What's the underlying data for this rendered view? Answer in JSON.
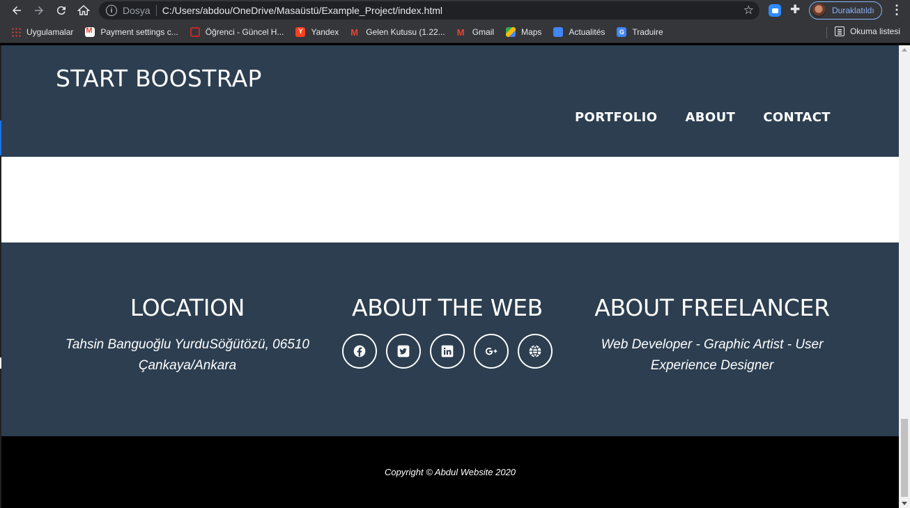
{
  "browser": {
    "address": {
      "scheme_label": "Dosya",
      "url": "C:/Users/abdou/OneDrive/Masaüstü/Example_Project/index.html"
    },
    "profile_label": "Duraklatıldı",
    "bookmarks": [
      {
        "label": "Uygulamalar",
        "icon": "apps-icon"
      },
      {
        "label": "Payment settings c...",
        "icon": "gmail-icon"
      },
      {
        "label": "Öğrenci - Güncel H...",
        "icon": "shield-icon"
      },
      {
        "label": "Yandex",
        "icon": "yandex-icon"
      },
      {
        "label": "Gelen Kutusu (1.22...",
        "icon": "gmail-icon"
      },
      {
        "label": "Gmail",
        "icon": "gmail-icon"
      },
      {
        "label": "Maps",
        "icon": "maps-icon"
      },
      {
        "label": "Actualités",
        "icon": "news-icon"
      },
      {
        "label": "Traduire",
        "icon": "translate-icon"
      }
    ],
    "reading_list_label": "Okuma listesi"
  },
  "site": {
    "brand": "START BOOSTRAP",
    "nav": [
      "PORTFOLIO",
      "ABOUT",
      "CONTACT"
    ]
  },
  "footer": {
    "location": {
      "title": "LOCATION",
      "text": "Tahsin Banguoğlu YurduSöğütözü, 06510 Çankaya/Ankara"
    },
    "web": {
      "title": "ABOUT THE WEB",
      "social": [
        "facebook-icon",
        "twitter-icon",
        "linkedin-icon",
        "google-plus-icon",
        "dribbble-icon"
      ]
    },
    "freelancer": {
      "title": "ABOUT FREELANCER",
      "text": "Web Developer - Graphic Artist - User Experience Designer"
    }
  },
  "copyright": "Copyright © Abdul Website 2020"
}
